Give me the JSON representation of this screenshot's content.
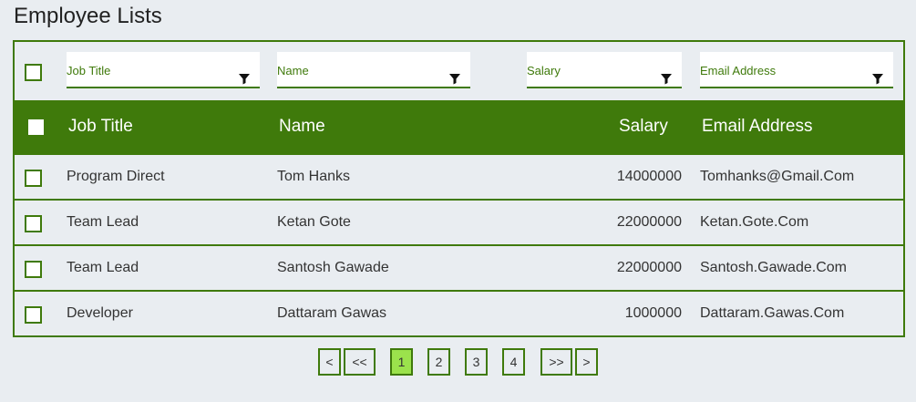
{
  "page": {
    "title": "Employee Lists"
  },
  "filters": {
    "job_title": {
      "placeholder": "Job Title"
    },
    "name": {
      "placeholder": "Name"
    },
    "salary": {
      "placeholder": "Salary"
    },
    "email": {
      "placeholder": "Email Address"
    }
  },
  "columns": {
    "job_title": "Job Title",
    "name": "Name",
    "salary": "Salary",
    "email": "Email Address"
  },
  "rows": [
    {
      "job_title": "Program Direct",
      "name": "Tom Hanks",
      "salary": "14000000",
      "email": "Tomhanks@Gmail.Com"
    },
    {
      "job_title": "Team Lead",
      "name": "Ketan Gote",
      "salary": "22000000",
      "email": "Ketan.Gote.Com"
    },
    {
      "job_title": "Team Lead",
      "name": "Santosh Gawade",
      "salary": "22000000",
      "email": "Santosh.Gawade.Com"
    },
    {
      "job_title": "Developer",
      "name": "Dattaram Gawas",
      "salary": "1000000",
      "email": "Dattaram.Gawas.Com"
    }
  ],
  "pagination": {
    "prev": "<",
    "first": "<<",
    "pages": [
      "1",
      "2",
      "3",
      "4"
    ],
    "last": ">>",
    "next": ">",
    "current_page": "1"
  },
  "colors": {
    "accent": "#3f7a0b",
    "active_page": "#9be24c",
    "background": "#e9edf1"
  }
}
